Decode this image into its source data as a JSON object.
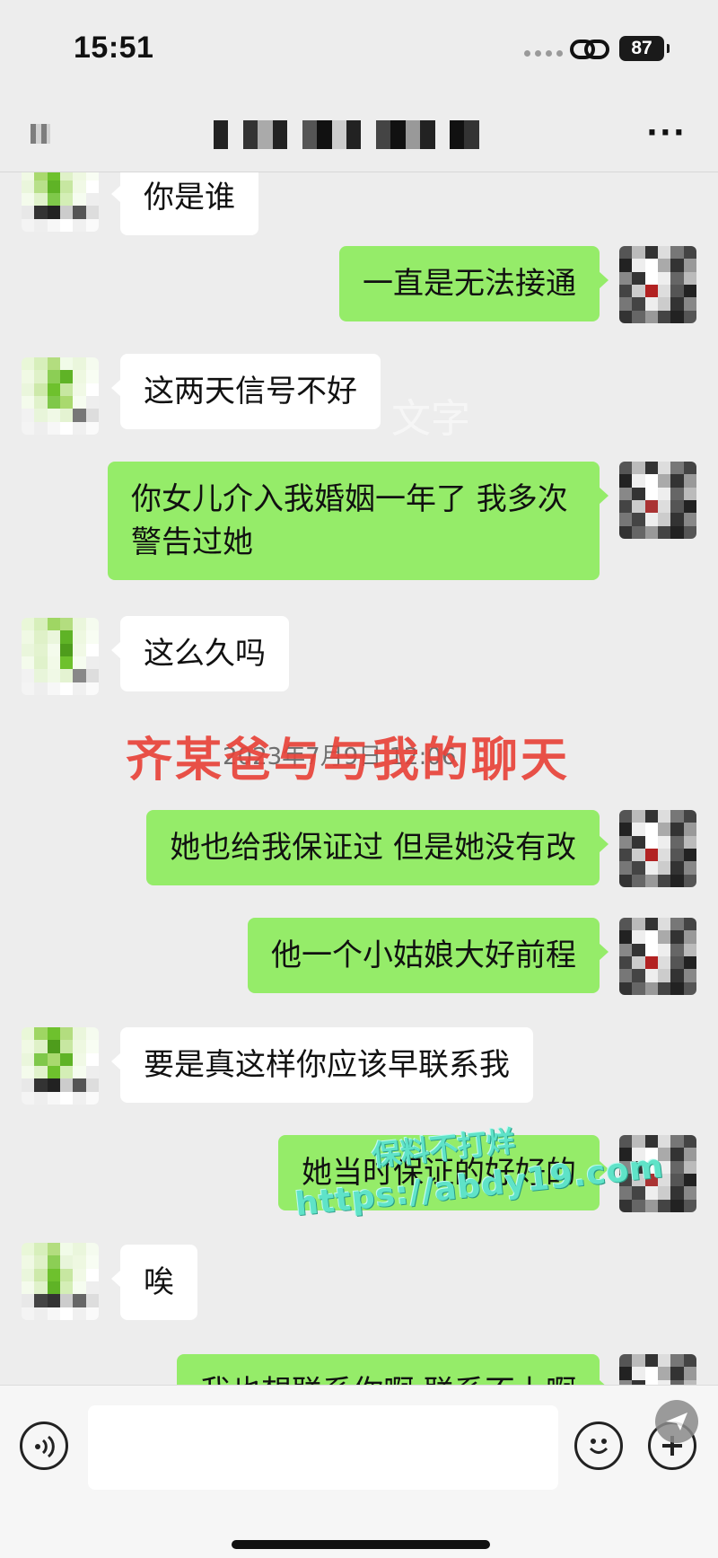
{
  "status_bar": {
    "time": "15:51",
    "battery": "87"
  },
  "nav": {
    "more_label": "···"
  },
  "messages": [
    {
      "side": "left",
      "text": "你是谁"
    },
    {
      "side": "right",
      "text": "一直是无法接通"
    },
    {
      "side": "left",
      "text": "这两天信号不好"
    },
    {
      "side": "right",
      "text": "你女儿介入我婚姻一年了  我多次警告过她"
    },
    {
      "side": "left",
      "text": "这么久吗"
    },
    {
      "side": "right",
      "text": "她也给我保证过  但是她没有改"
    },
    {
      "side": "right",
      "text": "他一个小姑娘大好前程"
    },
    {
      "side": "left",
      "text": "要是真这样你应该早联系我"
    },
    {
      "side": "right",
      "text": "她当时保证的好好的"
    },
    {
      "side": "left",
      "text": "唉"
    },
    {
      "side": "right",
      "text": "我也想联系你啊  联系不上啊"
    }
  ],
  "timestamp": "2023年7月9日 12:06",
  "overlay_caption": "齐某爸与与我的聊天",
  "watermarks": {
    "background_text": "文字",
    "brand_line_1": "保料不打烊",
    "brand_line_2": "https://abdy19.com"
  },
  "input_bar": {
    "placeholder": ""
  },
  "colors": {
    "bubble_self": "#95ec69",
    "bubble_other": "#ffffff",
    "background": "#ededed",
    "overlay_red": "#e8433a"
  }
}
